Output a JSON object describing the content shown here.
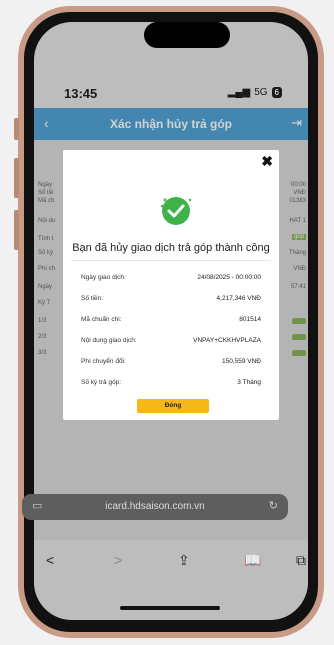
{
  "status": {
    "time": "13:45",
    "signal": "5G",
    "battery": "6"
  },
  "header": {
    "title": "Xác nhận hủy trả góp"
  },
  "modal": {
    "headline": "Bạn đã hủy giao dịch trả góp thành công",
    "details": [
      {
        "label": "Ngày giao dịch:",
        "value": "24/08/2025 - 00:00:00"
      },
      {
        "label": "Số tiền:",
        "value": "4,217,346 VNĐ"
      },
      {
        "label": "Mã chuẩn chi:",
        "value": "801514"
      },
      {
        "label": "Nội dung giao dịch:",
        "value": "VNPAY+CKKHVPLAZA"
      },
      {
        "label": "Phí chuyển đổi:",
        "value": "150,559 VNĐ"
      },
      {
        "label": "Số kỳ trả góp:",
        "value": "3 Tháng"
      }
    ],
    "close_button": "Đóng"
  },
  "background": {
    "left_labels": [
      "Ngày",
      "Số tiề",
      "Mã ch",
      "Nội du",
      "Tính t",
      "Số kỳ",
      "Phí ch",
      "Ngày",
      "Kỳ T",
      "1/3",
      "2/3",
      "3/3"
    ],
    "right_values": [
      "00:00",
      "VNĐ",
      "01383",
      "HAT 1",
      "góp",
      "Tháng",
      "VNĐ",
      "57:41"
    ]
  },
  "browser": {
    "url": "icard.hdsaison.com.vn"
  },
  "colors": {
    "appbar": "#3f98cf",
    "success": "#3fb24b",
    "button": "#f5b817",
    "phone_frame": "#c89b86"
  }
}
